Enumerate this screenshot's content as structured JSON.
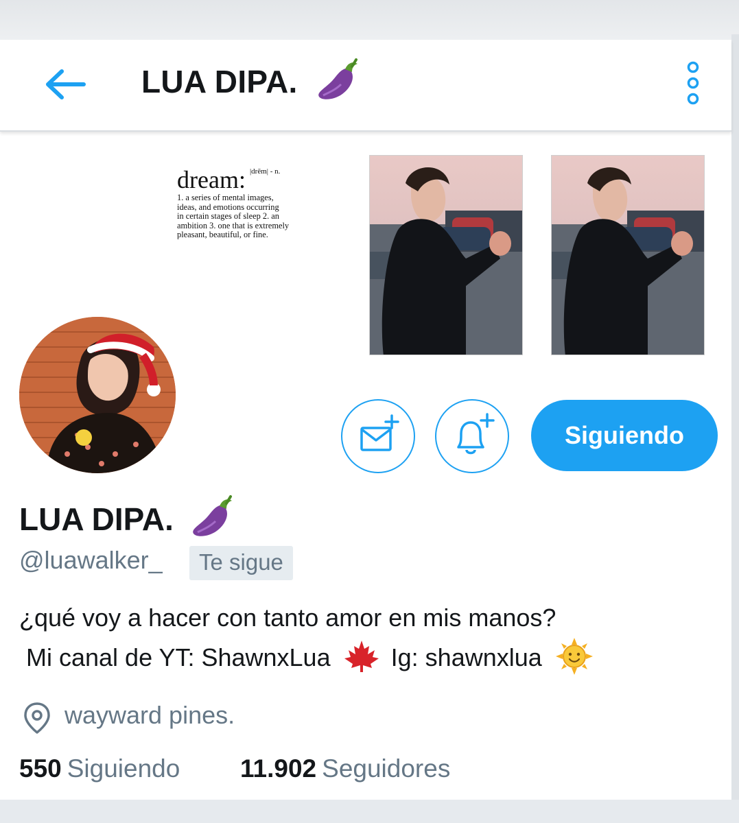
{
  "header": {
    "title": "LUA DIPA.",
    "title_emoji_icon": "eggplant-icon",
    "back_icon": "arrow-left-icon",
    "menu_icon": "more-vertical-icon"
  },
  "banner": {
    "definition_word": "dream:",
    "definition_pron": "|drēm| - n.",
    "definition_body": [
      "1. a series of mental images,",
      "ideas, and emotions occurring",
      "in certain stages of sleep 2. an",
      "ambition 3. one that is extremely",
      "pleasant, beautiful, or fine."
    ]
  },
  "actions": {
    "message_icon": "envelope-plus-icon",
    "notify_icon": "bell-plus-icon",
    "follow_label": "Siguiendo"
  },
  "profile": {
    "display_name": "LUA DIPA.",
    "handle": "@luawalker_",
    "follows_you": "Te sigue",
    "bio_line1": "¿qué voy a hacer con tanto amor en mis manos?",
    "bio_line2_a": "Mi canal de YT: ShawnxLua",
    "bio_line2_b": "Ig: shawnxlua",
    "location": "wayward pines."
  },
  "stats": {
    "following_count": "550",
    "following_label": "Siguiendo",
    "followers_count": "11.902",
    "followers_label": "Seguidores"
  },
  "colors": {
    "accent": "#1da1f2",
    "secondary_text": "#657786",
    "primary_text": "#14171a"
  }
}
